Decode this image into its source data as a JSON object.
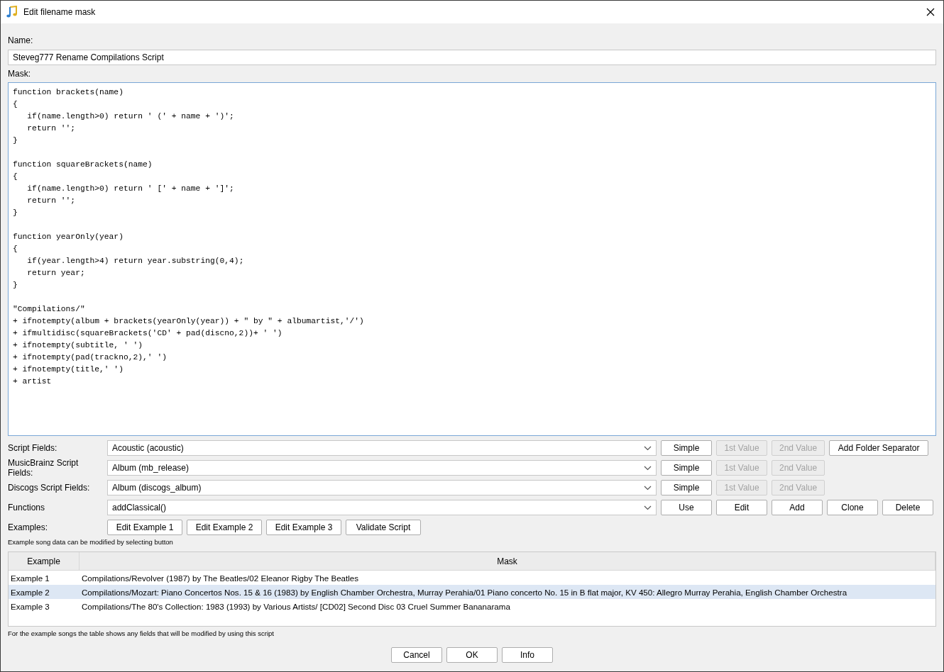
{
  "window": {
    "title": "Edit filename mask"
  },
  "name_field": {
    "label": "Name:",
    "value": "Steveg777 Rename Compilations Script"
  },
  "mask": {
    "label": "Mask:",
    "value": "function brackets(name)\n{\n   if(name.length>0) return ' (' + name + ')';\n   return '';\n}\n\nfunction squareBrackets(name)\n{\n   if(name.length>0) return ' [' + name + ']';\n   return '';\n}\n\nfunction yearOnly(year)\n{\n   if(year.length>4) return year.substring(0,4);\n   return year;\n}\n\n\"Compilations/\"\n+ ifnotempty(album + brackets(yearOnly(year)) + \" by \" + albumartist,'/')\n+ ifmultidisc(squareBrackets('CD' + pad(discno,2))+ ' ')\n+ ifnotempty(subtitle, ' ')\n+ ifnotempty(pad(trackno,2),' ')\n+ ifnotempty(title,' ')\n+ artist"
  },
  "field_rows": [
    {
      "label": "Script Fields:",
      "value": "Acoustic (acoustic)",
      "buttons": [
        {
          "label": "Simple",
          "disabled": false
        },
        {
          "label": "1st Value",
          "disabled": true
        },
        {
          "label": "2nd Value",
          "disabled": true
        },
        {
          "label": "Add Folder Separator",
          "disabled": false
        }
      ]
    },
    {
      "label": "MusicBrainz Script Fields:",
      "value": "Album (mb_release)",
      "buttons": [
        {
          "label": "Simple",
          "disabled": false
        },
        {
          "label": "1st Value",
          "disabled": true
        },
        {
          "label": "2nd Value",
          "disabled": true
        }
      ]
    },
    {
      "label": "Discogs Script Fields:",
      "value": "Album (discogs_album)",
      "buttons": [
        {
          "label": "Simple",
          "disabled": false
        },
        {
          "label": "1st Value",
          "disabled": true
        },
        {
          "label": "2nd Value",
          "disabled": true
        }
      ]
    },
    {
      "label": "Functions",
      "value": "addClassical()",
      "buttons": [
        {
          "label": "Use",
          "disabled": false
        },
        {
          "label": "Edit",
          "disabled": false
        },
        {
          "label": "Add",
          "disabled": false
        },
        {
          "label": "Clone",
          "disabled": false
        },
        {
          "label": "Delete",
          "disabled": false
        }
      ]
    }
  ],
  "examples": {
    "label": "Examples:",
    "buttons": [
      "Edit Example 1",
      "Edit Example 2",
      "Edit Example 3",
      "Validate Script"
    ],
    "note": "Example song data can be modified by selecting button"
  },
  "table": {
    "columns": [
      "Example",
      "Mask"
    ],
    "rows": [
      {
        "example": "Example 1",
        "mask": "Compilations/Revolver (1987) by The Beatles/02 Eleanor Rigby The Beatles",
        "selected": false
      },
      {
        "example": "Example 2",
        "mask": "Compilations/Mozart: Piano Concertos Nos. 15 & 16 (1983) by English Chamber Orchestra, Murray Perahia/01 Piano concerto No. 15 in B flat major, KV 450: Allegro Murray Perahia, English Chamber Orchestra",
        "selected": true
      },
      {
        "example": "Example 3",
        "mask": "Compilations/The 80's Collection: 1983 (1993) by Various Artists/ [CD02] Second Disc 03 Cruel Summer Bananarama",
        "selected": false
      }
    ]
  },
  "table_note": "For the example songs the table shows any fields that will be modified by using this script",
  "buttons": [
    "Cancel",
    "OK",
    "Info"
  ]
}
